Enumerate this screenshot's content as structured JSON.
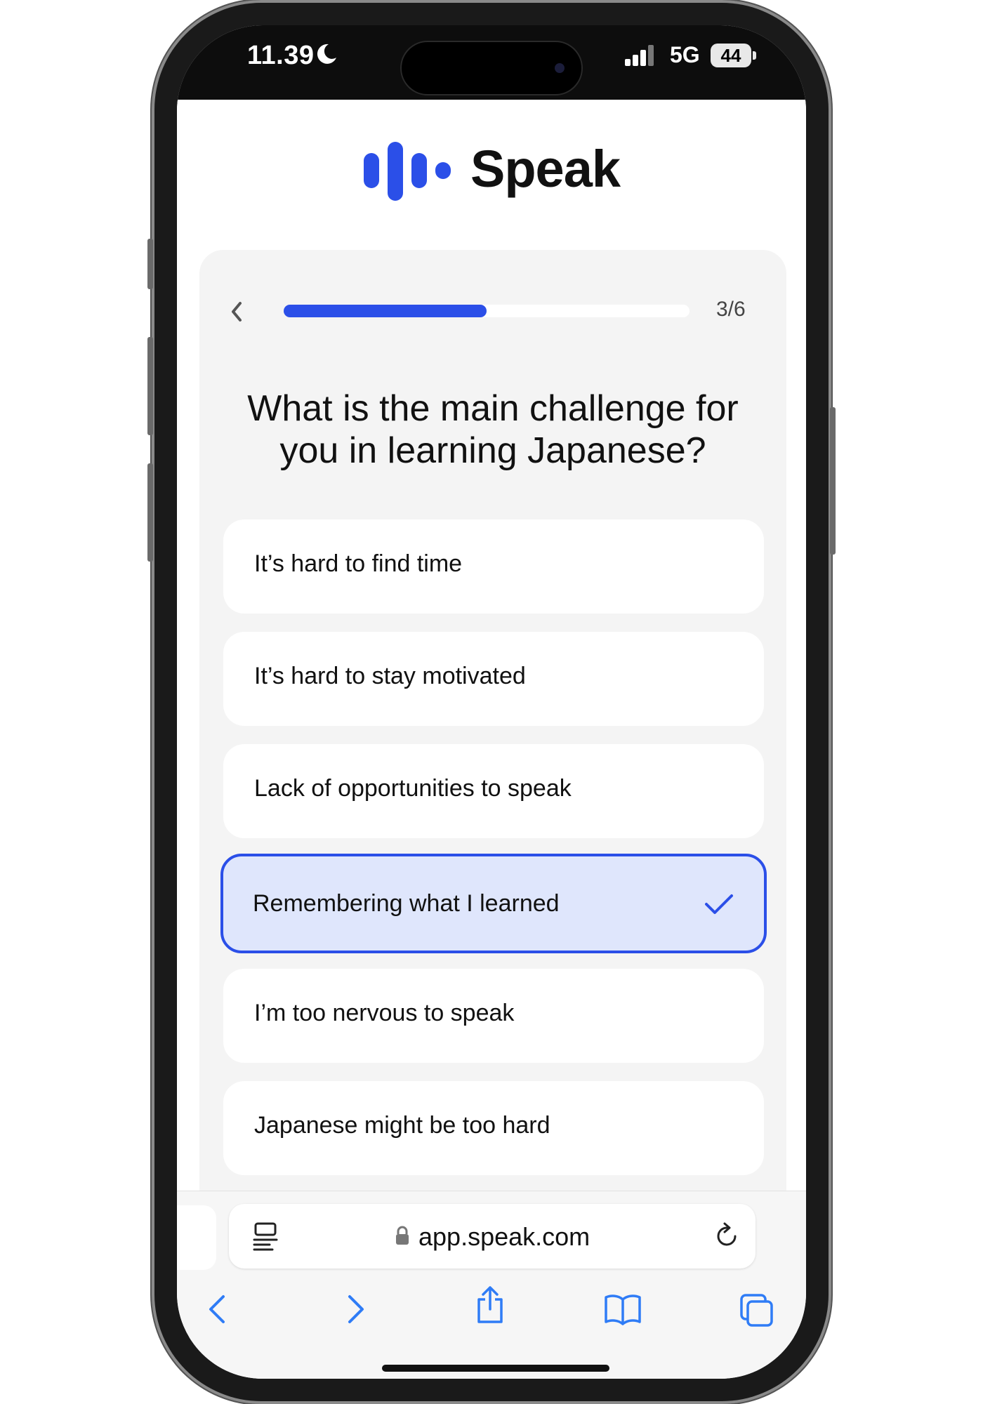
{
  "status_bar": {
    "time": "11.39",
    "network": "5G",
    "battery": "44"
  },
  "header": {
    "brand": "Speak"
  },
  "quiz": {
    "step": "3/6",
    "progress": 0.5,
    "question": "What is the main challenge for you in learning Japanese?",
    "options": [
      {
        "label": "It’s hard to find time",
        "selected": false
      },
      {
        "label": "It’s hard to stay motivated",
        "selected": false
      },
      {
        "label": "Lack of opportunities to speak",
        "selected": false
      },
      {
        "label": "Remembering what I learned",
        "selected": true
      },
      {
        "label": "I’m too nervous to speak",
        "selected": false
      },
      {
        "label": "Japanese might be too hard",
        "selected": false
      }
    ]
  },
  "browser": {
    "url": "app.speak.com"
  },
  "colors": {
    "accent": "#2b4fe8",
    "selected_bg": "#dfe6fc",
    "card_bg": "#f4f4f4",
    "ios_blue": "#2f7cf6"
  },
  "icons": {
    "status": [
      "moon-icon",
      "signal-icon",
      "battery-icon"
    ],
    "nav": [
      "back-icon",
      "forward-icon",
      "share-icon",
      "bookmarks-icon",
      "tabs-icon"
    ]
  }
}
